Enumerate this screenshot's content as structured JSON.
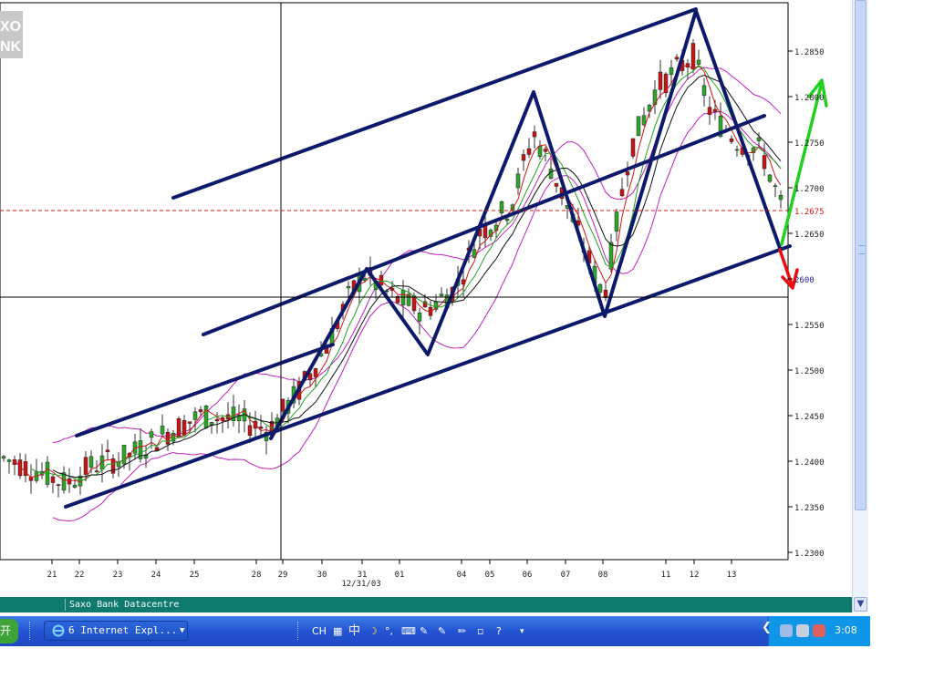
{
  "watermark": [
    "XO",
    "NK"
  ],
  "chart_data": {
    "type": "candlestick",
    "price_labels": [
      {
        "text": "1.2850",
        "value": 1.285
      },
      {
        "text": "1.2800",
        "value": 1.28
      },
      {
        "text": "1.2750",
        "value": 1.275
      },
      {
        "text": "1.2700",
        "value": 1.27
      },
      {
        "text": "1.2650",
        "value": 1.265
      },
      {
        "text": "2600",
        "value": 1.26
      },
      {
        "text": "1.2550",
        "value": 1.255
      },
      {
        "text": "1.2500",
        "value": 1.25
      },
      {
        "text": "1.2450",
        "value": 1.245
      },
      {
        "text": "1.2400",
        "value": 1.24
      },
      {
        "text": "1.2350",
        "value": 1.235
      },
      {
        "text": "1.2300",
        "value": 1.23
      }
    ],
    "current_price_label": "1.2675",
    "current_price": 1.2675,
    "crosshair_price": 1.258,
    "date_labels": [
      "21",
      "22",
      "23",
      "24",
      "25",
      "28",
      "29",
      "30",
      "31",
      "01",
      "04",
      "05",
      "06",
      "07",
      "08",
      "11",
      "12",
      "13"
    ],
    "crosshair_date_label": "12/31/03",
    "ylim": [
      1.229,
      1.2895
    ],
    "colors": {
      "up": "#2fa52c",
      "down": "#c01818",
      "trend": "#0d1a6b",
      "bollinger": "#c020c0",
      "ma_fast": "#d01818",
      "ma_mid": "#22a022",
      "ma_slow": "#101010",
      "arrow_up": "#22d022",
      "arrow_down": "#e81010",
      "price_line": "#d01818"
    }
  },
  "status_bar": {
    "text": "Saxo Bank Datacentre"
  },
  "taskbar": {
    "start_label": "开",
    "task_label": "6 Internet Expl...",
    "ime": [
      "CH",
      "中"
    ],
    "clock": "3:08"
  }
}
